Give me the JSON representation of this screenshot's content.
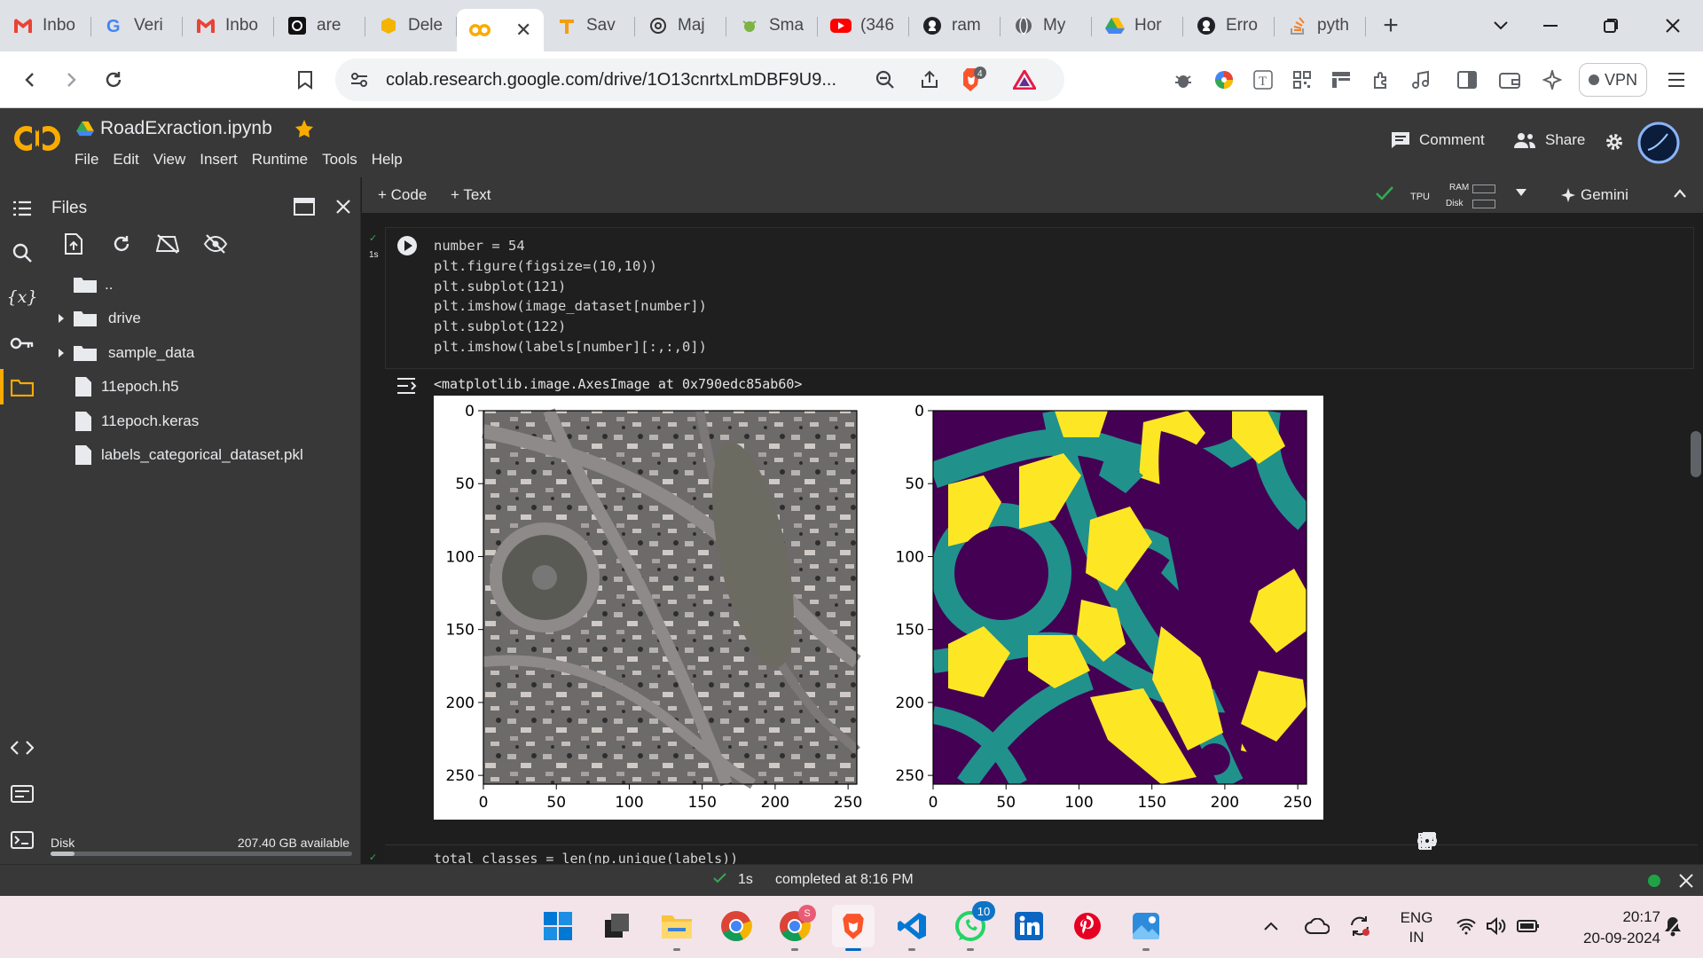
{
  "browser": {
    "tabs": [
      {
        "label": "Inbo",
        "icon": "gmail-icon"
      },
      {
        "label": "Veri",
        "icon": "google-icon"
      },
      {
        "label": "Inbo",
        "icon": "gmail-icon"
      },
      {
        "label": "are",
        "icon": "openai-icon"
      },
      {
        "label": "Dele",
        "icon": "box-icon"
      },
      {
        "label": "",
        "icon": "colab-icon",
        "active": true
      },
      {
        "label": "Sav",
        "icon": "translate-icon"
      },
      {
        "label": "Maj",
        "icon": "chatgpt-icon"
      },
      {
        "label": "Sma",
        "icon": "bug-icon"
      },
      {
        "label": "(346",
        "icon": "youtube-icon"
      },
      {
        "label": "ram",
        "icon": "github-icon"
      },
      {
        "label": "My",
        "icon": "globe-icon"
      },
      {
        "label": "Hor",
        "icon": "drive-icon"
      },
      {
        "label": "Erro",
        "icon": "github-icon"
      },
      {
        "label": "pyth",
        "icon": "stackoverflow-icon"
      }
    ],
    "url": "colab.research.google.com/drive/1O13cnrtxLmDBF9U9...",
    "vpn_label": "VPN",
    "brave_badge": "4"
  },
  "colab": {
    "notebook_title": "RoadExraction.ipynb",
    "menu": [
      "File",
      "Edit",
      "View",
      "Insert",
      "Runtime",
      "Tools",
      "Help"
    ],
    "comment_label": "Comment",
    "share_label": "Share",
    "add_code_label": "+ Code",
    "add_text_label": "+ Text",
    "runtime_type": "TPU",
    "ram_label": "RAM",
    "disk_label": "Disk",
    "gemini_label": "Gemini"
  },
  "files_panel": {
    "title": "Files",
    "items": [
      {
        "label": "..",
        "kind": "folder"
      },
      {
        "label": "drive",
        "kind": "folder",
        "expandable": true
      },
      {
        "label": "sample_data",
        "kind": "folder",
        "expandable": true
      },
      {
        "label": "11epoch.h5",
        "kind": "file"
      },
      {
        "label": "11epoch.keras",
        "kind": "file"
      },
      {
        "label": "labels_categorical_dataset.pkl",
        "kind": "file"
      }
    ],
    "disk_label": "Disk",
    "disk_available": "207.40 GB available",
    "disk_used_fraction": 0.08
  },
  "cell": {
    "exec_time": "1s",
    "code_lines": [
      "number = 54",
      "plt.figure(figsize=(10,10))",
      "plt.subplot(121)",
      "plt.imshow(image_dataset[number])",
      "plt.subplot(122)",
      "plt.imshow(labels[number][:,:,0])"
    ],
    "output_text": "<matplotlib.image.AxesImage at 0x790edc85ab60>",
    "next_cell_code": "total_classes = len(np.unique(labels))"
  },
  "chart_data": [
    {
      "type": "image",
      "x": [
        0,
        256
      ],
      "y": [
        0,
        256
      ],
      "xticks": [
        "0",
        "50",
        "100",
        "150",
        "200",
        "250"
      ],
      "yticks": [
        "0",
        "50",
        "100",
        "150",
        "200",
        "250"
      ]
    },
    {
      "type": "heatmap",
      "x": [
        0,
        256
      ],
      "y": [
        0,
        256
      ],
      "xticks": [
        "0",
        "50",
        "100",
        "150",
        "200",
        "250"
      ],
      "yticks": [
        "0",
        "50",
        "100",
        "150",
        "200",
        "250"
      ],
      "colors": [
        "#440154",
        "#21918c",
        "#fde725"
      ]
    }
  ],
  "status": {
    "time": "1s",
    "completed_text": "completed at 8:16 PM",
    "connected_color": "#1ea446"
  },
  "taskbar": {
    "lang_top": "ENG",
    "lang_bottom": "IN",
    "clock_time": "20:17",
    "clock_date": "20-09-2024",
    "chrome_badge": "S",
    "whatsapp_badge": "10"
  }
}
